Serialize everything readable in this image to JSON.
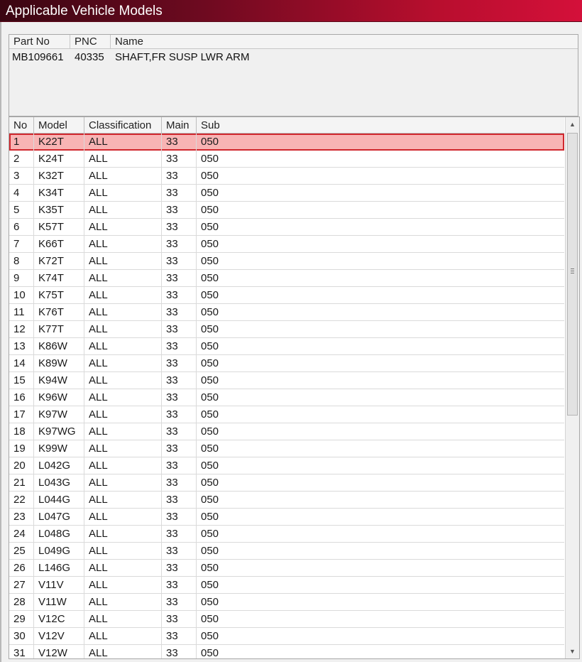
{
  "window": {
    "title": "Applicable Vehicle Models"
  },
  "part": {
    "headers": {
      "part_no": "Part No",
      "pnc": "PNC",
      "name": "Name"
    },
    "part_no": "MB109661",
    "pnc": "40335",
    "name": "SHAFT,FR SUSP LWR ARM"
  },
  "models": {
    "headers": {
      "no": "No",
      "model": "Model",
      "classification": "Classification",
      "main": "Main",
      "sub": "Sub"
    },
    "selected_index": 0,
    "rows": [
      {
        "no": "1",
        "model": "K22T",
        "classification": "ALL",
        "main": "33",
        "sub": "050"
      },
      {
        "no": "2",
        "model": "K24T",
        "classification": "ALL",
        "main": "33",
        "sub": "050"
      },
      {
        "no": "3",
        "model": "K32T",
        "classification": "ALL",
        "main": "33",
        "sub": "050"
      },
      {
        "no": "4",
        "model": "K34T",
        "classification": "ALL",
        "main": "33",
        "sub": "050"
      },
      {
        "no": "5",
        "model": "K35T",
        "classification": "ALL",
        "main": "33",
        "sub": "050"
      },
      {
        "no": "6",
        "model": "K57T",
        "classification": "ALL",
        "main": "33",
        "sub": "050"
      },
      {
        "no": "7",
        "model": "K66T",
        "classification": "ALL",
        "main": "33",
        "sub": "050"
      },
      {
        "no": "8",
        "model": "K72T",
        "classification": "ALL",
        "main": "33",
        "sub": "050"
      },
      {
        "no": "9",
        "model": "K74T",
        "classification": "ALL",
        "main": "33",
        "sub": "050"
      },
      {
        "no": "10",
        "model": "K75T",
        "classification": "ALL",
        "main": "33",
        "sub": "050"
      },
      {
        "no": "11",
        "model": "K76T",
        "classification": "ALL",
        "main": "33",
        "sub": "050"
      },
      {
        "no": "12",
        "model": "K77T",
        "classification": "ALL",
        "main": "33",
        "sub": "050"
      },
      {
        "no": "13",
        "model": "K86W",
        "classification": "ALL",
        "main": "33",
        "sub": "050"
      },
      {
        "no": "14",
        "model": "K89W",
        "classification": "ALL",
        "main": "33",
        "sub": "050"
      },
      {
        "no": "15",
        "model": "K94W",
        "classification": "ALL",
        "main": "33",
        "sub": "050"
      },
      {
        "no": "16",
        "model": "K96W",
        "classification": "ALL",
        "main": "33",
        "sub": "050"
      },
      {
        "no": "17",
        "model": "K97W",
        "classification": "ALL",
        "main": "33",
        "sub": "050"
      },
      {
        "no": "18",
        "model": "K97WG",
        "classification": "ALL",
        "main": "33",
        "sub": "050"
      },
      {
        "no": "19",
        "model": "K99W",
        "classification": "ALL",
        "main": "33",
        "sub": "050"
      },
      {
        "no": "20",
        "model": "L042G",
        "classification": "ALL",
        "main": "33",
        "sub": "050"
      },
      {
        "no": "21",
        "model": "L043G",
        "classification": "ALL",
        "main": "33",
        "sub": "050"
      },
      {
        "no": "22",
        "model": "L044G",
        "classification": "ALL",
        "main": "33",
        "sub": "050"
      },
      {
        "no": "23",
        "model": "L047G",
        "classification": "ALL",
        "main": "33",
        "sub": "050"
      },
      {
        "no": "24",
        "model": "L048G",
        "classification": "ALL",
        "main": "33",
        "sub": "050"
      },
      {
        "no": "25",
        "model": "L049G",
        "classification": "ALL",
        "main": "33",
        "sub": "050"
      },
      {
        "no": "26",
        "model": "L146G",
        "classification": "ALL",
        "main": "33",
        "sub": "050"
      },
      {
        "no": "27",
        "model": "V11V",
        "classification": "ALL",
        "main": "33",
        "sub": "050"
      },
      {
        "no": "28",
        "model": "V11W",
        "classification": "ALL",
        "main": "33",
        "sub": "050"
      },
      {
        "no": "29",
        "model": "V12C",
        "classification": "ALL",
        "main": "33",
        "sub": "050"
      },
      {
        "no": "30",
        "model": "V12V",
        "classification": "ALL",
        "main": "33",
        "sub": "050"
      },
      {
        "no": "31",
        "model": "V12W",
        "classification": "ALL",
        "main": "33",
        "sub": "050"
      }
    ]
  },
  "scrollbar": {
    "up_icon": "scroll-up-arrow-icon",
    "down_icon": "scroll-down-arrow-icon"
  }
}
